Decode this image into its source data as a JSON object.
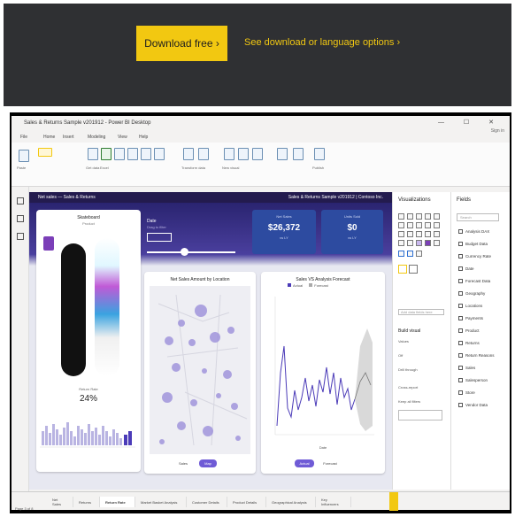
{
  "banner": {
    "download_label": "Download free  ›",
    "options_label": "See download or language options  ›"
  },
  "window": {
    "title": "Sales & Returns Sample v201912 - Power BI Desktop",
    "user": "Sign in",
    "controls": "—  ☐  ✕"
  },
  "menu": [
    "File",
    "Home",
    "Insert",
    "Modeling",
    "View",
    "Help"
  ],
  "ribbon": [
    {
      "label": "Paste",
      "icon": "paste-icon"
    },
    {
      "label": "Get data",
      "icon": "get-data-icon"
    },
    {
      "label": "Excel",
      "icon": "excel-icon"
    },
    {
      "label": "Power BI datasets",
      "icon": "dataset-icon"
    },
    {
      "label": "SQL Server",
      "icon": "sql-icon"
    },
    {
      "label": "Enter data",
      "icon": "enter-data-icon"
    },
    {
      "label": "Recent sources",
      "icon": "recent-icon"
    },
    {
      "label": "Transform data",
      "icon": "transform-icon"
    },
    {
      "label": "Refresh",
      "icon": "refresh-icon"
    },
    {
      "label": "New visual",
      "icon": "new-visual-icon"
    },
    {
      "label": "Text box",
      "icon": "text-box-icon"
    },
    {
      "label": "More visuals",
      "icon": "more-visuals-icon"
    },
    {
      "label": "New measure",
      "icon": "measure-icon"
    },
    {
      "label": "Quick measure",
      "icon": "quick-measure-icon"
    },
    {
      "label": "Publish",
      "icon": "publish-icon"
    }
  ],
  "report": {
    "header_left": "Net sales — Sales & Returns",
    "header_right": "Sales & Returns Sample v201912 | Contoso Inc.",
    "product": {
      "title": "Skateboard",
      "subtitle": "Product"
    },
    "return_rate": {
      "label": "Return Rate",
      "value": "24%"
    },
    "slider": {
      "label": "Date",
      "sub": "Drag to filter"
    },
    "kpis": [
      {
        "label": "Net Sales",
        "value": "$26,372",
        "sub": "vs LY"
      },
      {
        "label": "Units Sold",
        "value": "$0",
        "sub": "vs LY"
      }
    ],
    "map_title": "Net Sales Amount by Location",
    "line_title": "Sales VS Analysis Forecast",
    "line_legend": [
      "Actual",
      "Forecast"
    ],
    "map_chips": [
      "Sales",
      "Map"
    ],
    "line_chips": [
      "Actual",
      "Forecast"
    ],
    "line_xlabel": "Date"
  },
  "panes": {
    "visualizations": {
      "title": "Visualizations",
      "section": "Build visual",
      "wells": [
        "Values",
        "Add data fields here",
        "Drill through",
        "Cross-report"
      ],
      "toggle_label": "Off",
      "keep_filters": "Keep all filters"
    },
    "fields": {
      "title": "Fields",
      "search": "Search",
      "items": [
        "Analysis DAX",
        "Budget Data",
        "Currency Rate",
        "Date",
        "Forecast Data",
        "Geography",
        "Locations",
        "Payments",
        "Product",
        "Returns",
        "Return Reasons",
        "Sales",
        "Salesperson",
        "Store",
        "Vendor Data"
      ]
    }
  },
  "pages": [
    "Net Sales",
    "Returns",
    "Return Rate",
    "Market Basket Analysis",
    "Customer Details",
    "Product Details",
    "Geographical Analysis",
    "Key Influencers"
  ],
  "active_page": "Return Rate",
  "zoom": "Page 3 of 8",
  "colors": {
    "accent": "#f2c811",
    "report_header": "#231b4e",
    "kpi": "#2d4ba0",
    "purple": "#6f5bd6"
  }
}
